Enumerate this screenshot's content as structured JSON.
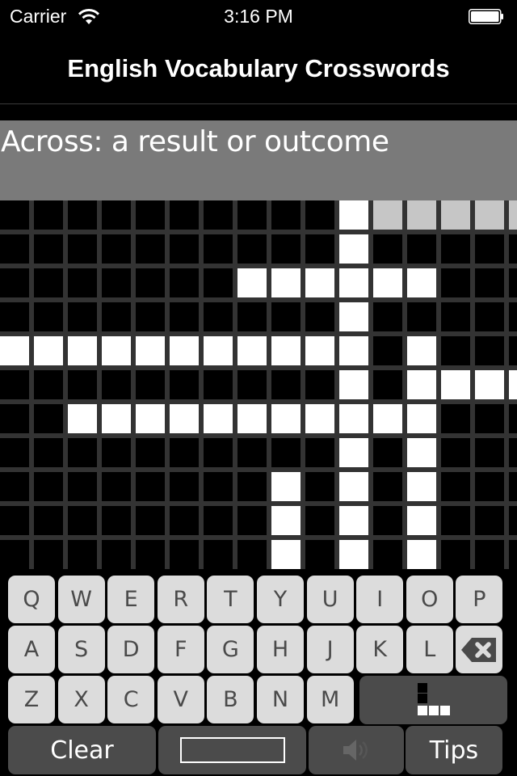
{
  "status_bar": {
    "carrier": "Carrier",
    "time": "3:16 PM",
    "wifi_icon": "wifi-icon",
    "battery_icon": "battery-full-icon",
    "battery_level": 1.0
  },
  "nav": {
    "title": "English Vocabulary Crosswords"
  },
  "clue": {
    "direction": "Across",
    "text": "Across: a result or outcome"
  },
  "colors": {
    "background": "#000000",
    "grid_line": "#333333",
    "cell_blocked": "#000000",
    "cell_open": "#ffffff",
    "cell_highlight": "#c6c6c6",
    "clue_bar": "#7a7a7a",
    "key_light": "#dcdcdc",
    "key_dark": "#4b4b4b"
  },
  "grid": {
    "rows": 11,
    "cols": 16,
    "cells": [
      "..........OHHHHH",
      "..........O.....",
      ".......OOOOOO...",
      "..........O.....",
      "OOOOOOOOOOO.O...",
      "..........O.OOOO",
      "..OOOOOOOOOOO...",
      "..........O.O...",
      "........O.O.O...",
      "........O.O.O...",
      "........O.O.O..."
    ],
    "legend": {
      ".": "blocked",
      "O": "open",
      "H": "highlighted"
    }
  },
  "keyboard": {
    "rows": [
      [
        "Q",
        "W",
        "E",
        "R",
        "T",
        "Y",
        "U",
        "I",
        "O",
        "P"
      ],
      [
        "A",
        "S",
        "D",
        "F",
        "G",
        "H",
        "J",
        "K",
        "L"
      ],
      [
        "Z",
        "X",
        "C",
        "V",
        "B",
        "N",
        "M"
      ]
    ],
    "backspace_icon": "backspace-icon",
    "toggle_direction_icon": "direction-toggle-icon",
    "clear_label": "Clear",
    "answer_value": "",
    "speaker_icon": "speaker-icon",
    "tips_label": "Tips"
  }
}
